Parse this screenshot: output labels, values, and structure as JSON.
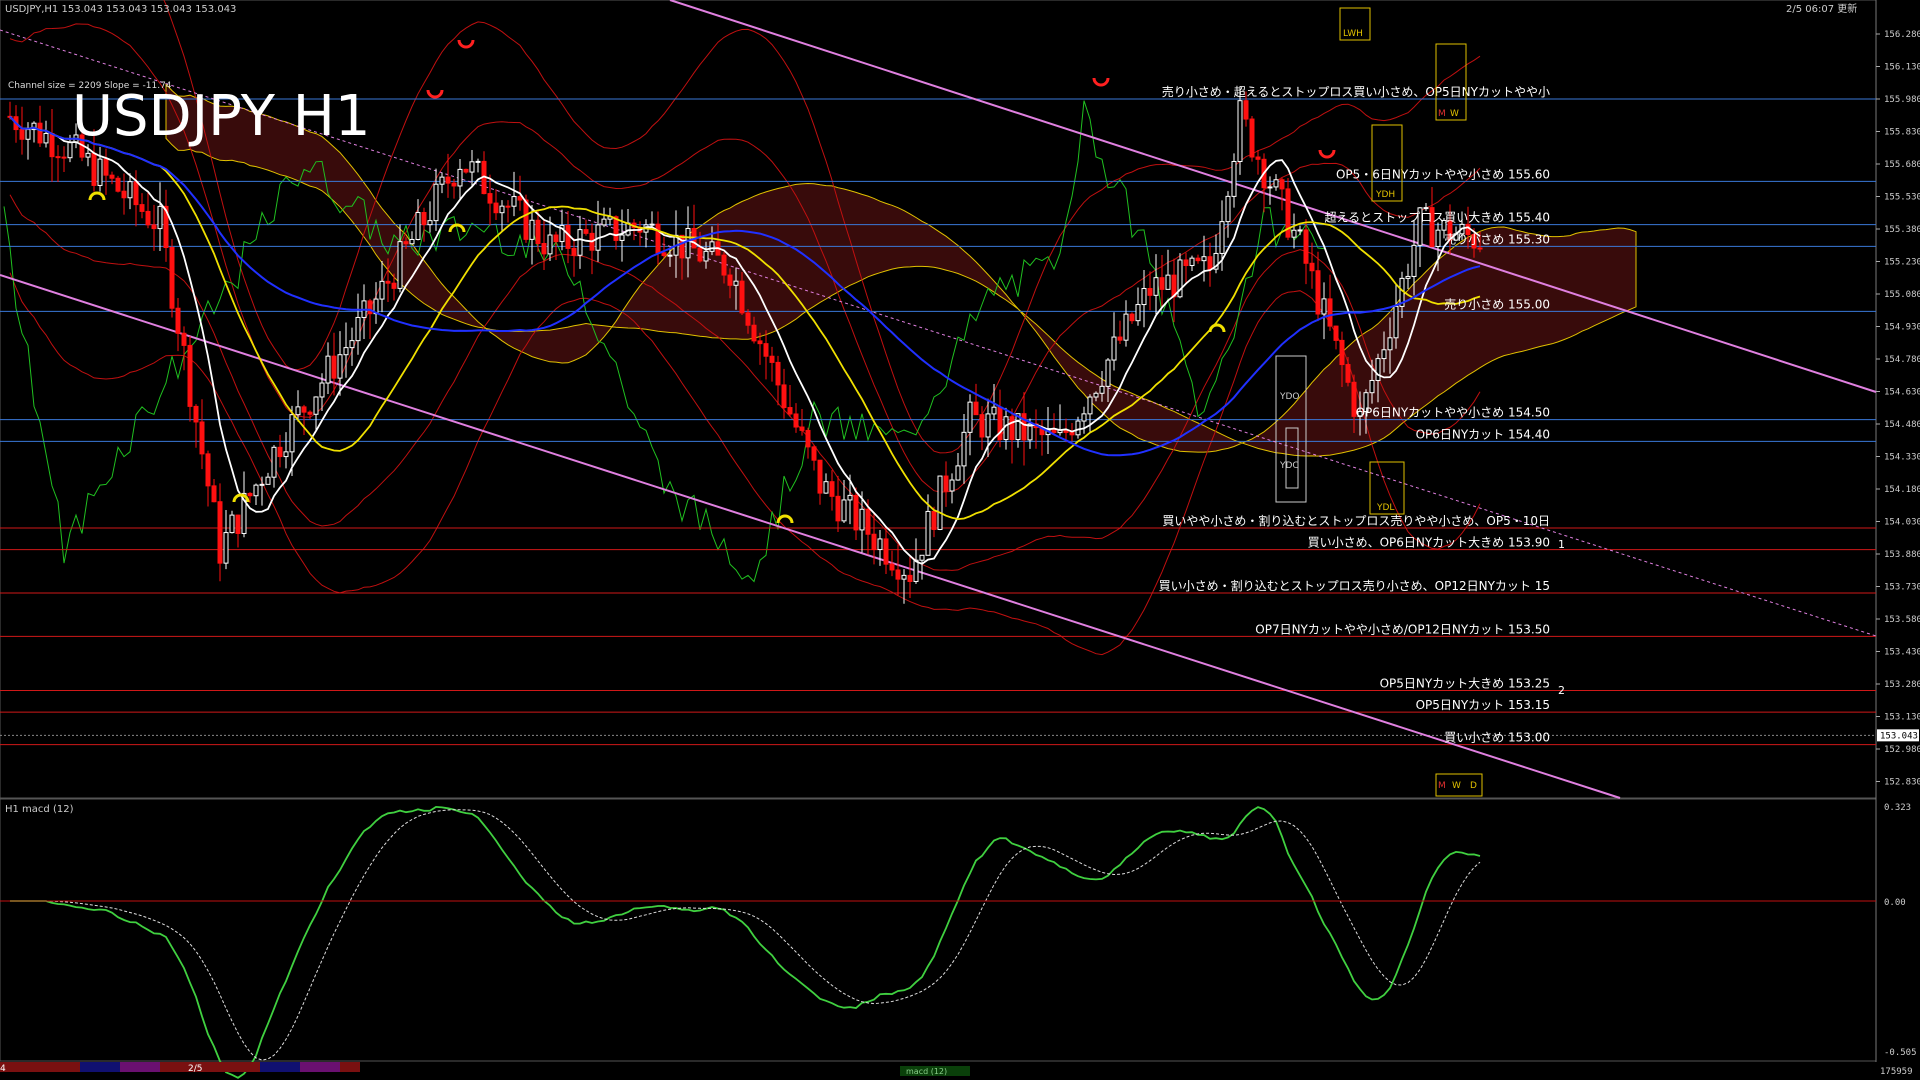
{
  "window": {
    "symbol_header": "USDJPY,H1  153.043 153.043 153.043 153.043",
    "clock": "2/5 06:07 更新",
    "watermark": "USDJPY H1",
    "channel_info": "Channel size = 2209  Slope = -11.74"
  },
  "price_axis": {
    "labels": [
      "156.280",
      "156.130",
      "155.980",
      "155.830",
      "155.680",
      "155.530",
      "155.380",
      "155.230",
      "155.080",
      "154.930",
      "154.780",
      "154.630",
      "154.480",
      "154.330",
      "154.180",
      "154.030",
      "153.880",
      "153.730",
      "153.580",
      "153.430",
      "153.280",
      "153.130",
      "152.980",
      "152.830"
    ],
    "current": "153.043"
  },
  "levels": [
    {
      "text": "売り小さめ・超えるとストップロス買い小さめ、OP5日NYカットやや小",
      "price": 155.98,
      "color": "#3a78d8"
    },
    {
      "text": "OP5・6日NYカットやや小さめ 155.60",
      "price": 155.6,
      "color": "#3a78d8"
    },
    {
      "text": "超えるとストップロス買い大きめ 155.40",
      "price": 155.4,
      "color": "#3a78d8"
    },
    {
      "text": "売り小さめ 155.30",
      "price": 155.3,
      "color": "#3a78d8"
    },
    {
      "text": "売り小さめ 155.00",
      "price": 155.0,
      "color": "#3a78d8"
    },
    {
      "text": "OP6日NYカットやや小さめ 154.50",
      "price": 154.5,
      "color": "#3a78d8"
    },
    {
      "text": "OP6日NYカット 154.40",
      "price": 154.4,
      "color": "#3a78d8"
    },
    {
      "text": "買いやや小さめ・割り込むとストップロス売りやや小さめ、OP5・10日",
      "price": 154.0,
      "color": "#d01818"
    },
    {
      "text": "買い小さめ、OP6日NYカット大きめ 153.90",
      "price": 153.9,
      "color": "#d01818"
    },
    {
      "text": "買い小さめ・割り込むとストップロス売り小さめ、OP12日NYカット 15",
      "price": 153.7,
      "color": "#d01818"
    },
    {
      "text": "OP7日NYカットやや小さめ/OP12日NYカット 153.50",
      "price": 153.5,
      "color": "#d01818"
    },
    {
      "text": "OP5日NYカット大きめ 153.25",
      "price": 153.25,
      "color": "#d01818"
    },
    {
      "text": "OP5日NYカット 153.15",
      "price": 153.15,
      "color": "#d01818"
    },
    {
      "text": "買い小さめ 153.00",
      "price": 153.0,
      "color": "#d01818"
    }
  ],
  "markers": {
    "lwh": "LWH",
    "ydh": "YDH",
    "ydo": "YDO",
    "ydc": "YDC",
    "ydl": "YDL",
    "m": "M",
    "w": "W",
    "d": "D",
    "n1": "1",
    "n2": "2"
  },
  "macd": {
    "label": "H1  macd (12)",
    "axis_top": "0.323",
    "axis_zero": "0.00",
    "axis_bottom": "-0.505"
  },
  "bottom_bar": {
    "left_label": "4",
    "date_label": "2/5",
    "tab_label": "macd (12)",
    "right_value": "175959"
  },
  "colors": {
    "bull": "#ffffff",
    "bear": "#ff1010",
    "ma_white": "#ffffff",
    "ma_yellow": "#f0e000",
    "ma_blue": "#2030ff",
    "channel": "#e080e0",
    "bollinger": "#c01010",
    "chikou": "#20c020",
    "kumo": "#a02020"
  }
}
